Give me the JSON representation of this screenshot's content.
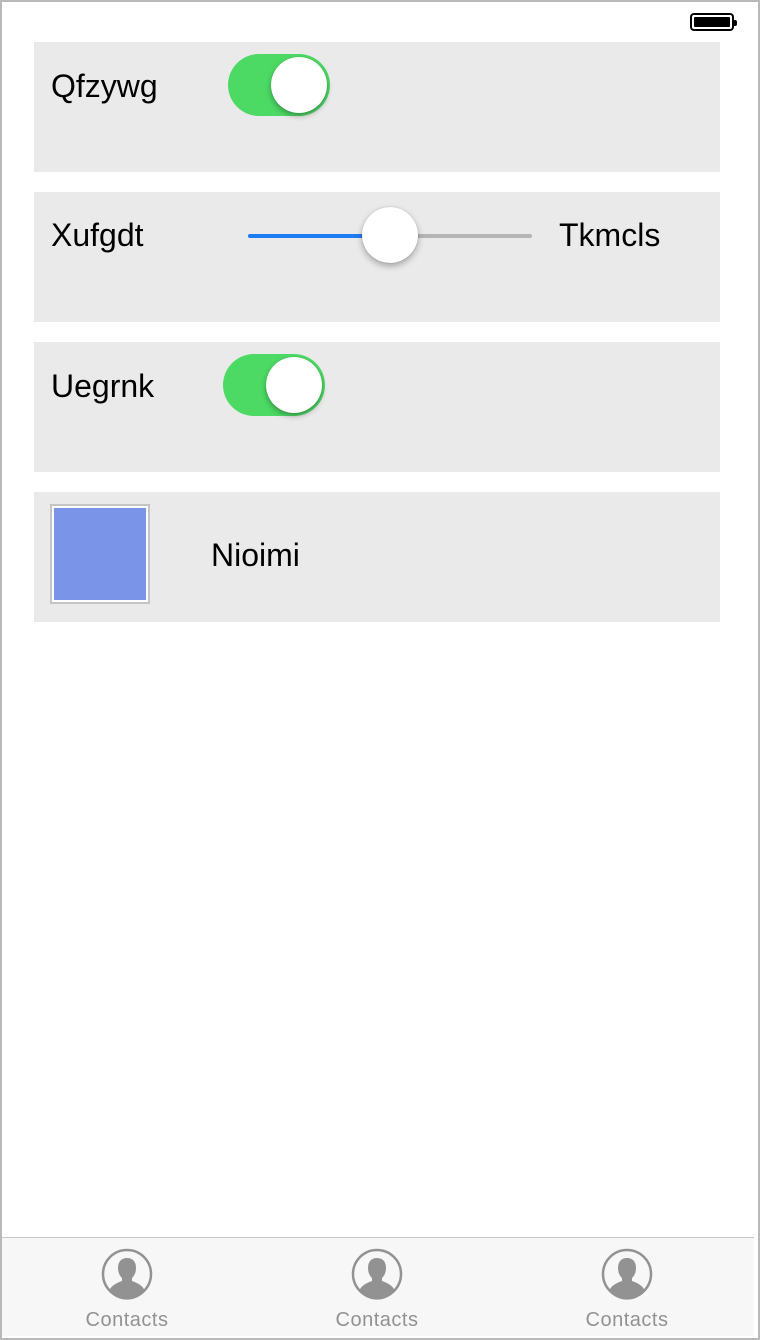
{
  "status_bar": {
    "battery_icon": "battery-full-icon"
  },
  "rows": [
    {
      "type": "switch",
      "label": "Qfzywg",
      "on": true
    },
    {
      "type": "slider",
      "label": "Xufgdt",
      "value_label": "Tkmcls",
      "value_fraction": 0.5
    },
    {
      "type": "switch",
      "label": "Uegrnk",
      "on": true
    },
    {
      "type": "color",
      "label": "Nioimi",
      "color": "#7a94e8"
    }
  ],
  "colors": {
    "switch_on": "#4cd964",
    "slider_min": "#1e7cf2",
    "card_bg": "#eaeaea"
  },
  "tabbar": {
    "tabs": [
      {
        "label": "Contacts",
        "icon": "contact-icon"
      },
      {
        "label": "Contacts",
        "icon": "contact-icon"
      },
      {
        "label": "Contacts",
        "icon": "contact-icon"
      }
    ]
  }
}
